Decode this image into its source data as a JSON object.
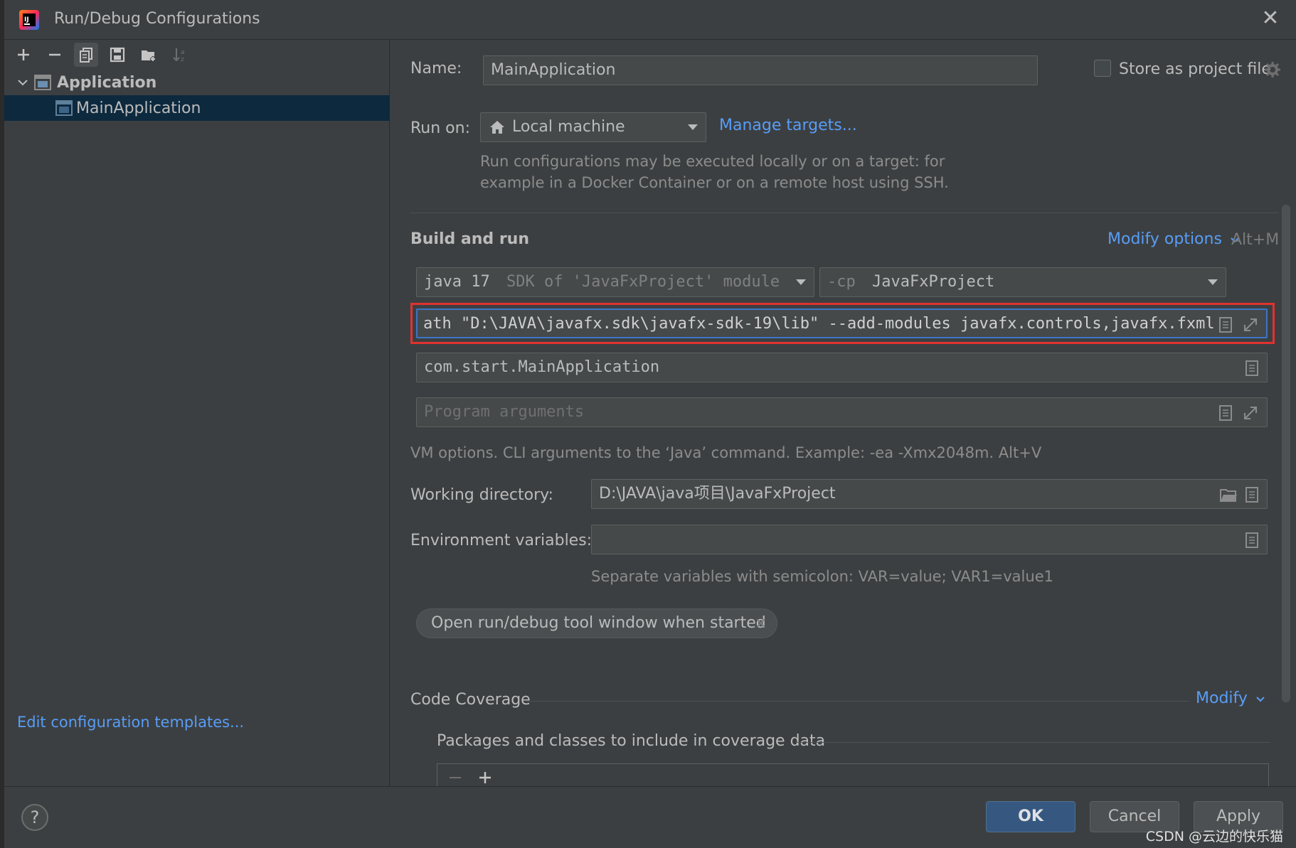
{
  "window": {
    "title": "Run/Debug Configurations",
    "app_icon": "intellij-idea-icon",
    "close_icon": "close-icon"
  },
  "toolbar": {
    "buttons": [
      {
        "icon": "add-icon",
        "label": "Add"
      },
      {
        "icon": "remove-icon",
        "label": "Remove"
      },
      {
        "icon": "copy-icon",
        "label": "Copy"
      },
      {
        "icon": "save-icon",
        "label": "Save"
      },
      {
        "icon": "new-folder-icon",
        "label": "Create folder"
      },
      {
        "icon": "sort-icon",
        "label": "Sort"
      }
    ]
  },
  "tree": {
    "group": {
      "label": "Application",
      "expanded": true
    },
    "items": [
      {
        "label": "MainApplication",
        "selected": true
      }
    ]
  },
  "left_footer": {
    "edit_templates": "Edit configuration templates..."
  },
  "form": {
    "name_label": "Name:",
    "name_value": "MainApplication",
    "store_as_project_file": "Store as project file",
    "run_on_label": "Run on:",
    "run_on_value": "Local machine",
    "manage_targets": "Manage targets...",
    "run_on_hint_line1": "Run configurations may be executed locally or on a target: for",
    "run_on_hint_line2": "example in a Docker Container or on a remote host using SSH.",
    "build_and_run": "Build and run",
    "modify_options": "Modify options",
    "modify_options_shortcut": "Alt+M",
    "jre_main": "java 17",
    "jre_sub": "SDK of 'JavaFxProject' module",
    "cp_prefix": "-cp",
    "cp_value": "JavaFxProject",
    "vm_options_value": "ath \"D:\\JAVA\\javafx.sdk\\javafx-sdk-19\\lib\" --add-modules javafx.controls,javafx.fxml",
    "main_class_value": "com.start.MainApplication",
    "program_args_placeholder": "Program arguments",
    "vm_hint": "VM options. CLI arguments to the ‘Java’ command. Example: -ea -Xmx2048m. Alt+V",
    "working_dir_label": "Working directory:",
    "working_dir_value": "D:\\JAVA\\java项目\\JavaFxProject",
    "env_label": "Environment variables:",
    "env_value": "",
    "env_hint": "Separate variables with semicolon: VAR=value; VAR1=value1",
    "chip_label": "Open run/debug tool window when started",
    "code_coverage": "Code Coverage",
    "modify": "Modify",
    "packages_label": "Packages and classes to include in coverage data"
  },
  "buttons": {
    "ok": "OK",
    "cancel": "Cancel",
    "apply": "Apply",
    "help": "?"
  },
  "watermark": "CSDN @云边的快乐猫",
  "colors": {
    "accent": "#589df6",
    "highlight_box": "#e0322f",
    "selection": "#0d293e",
    "ok_button": "#365880"
  }
}
